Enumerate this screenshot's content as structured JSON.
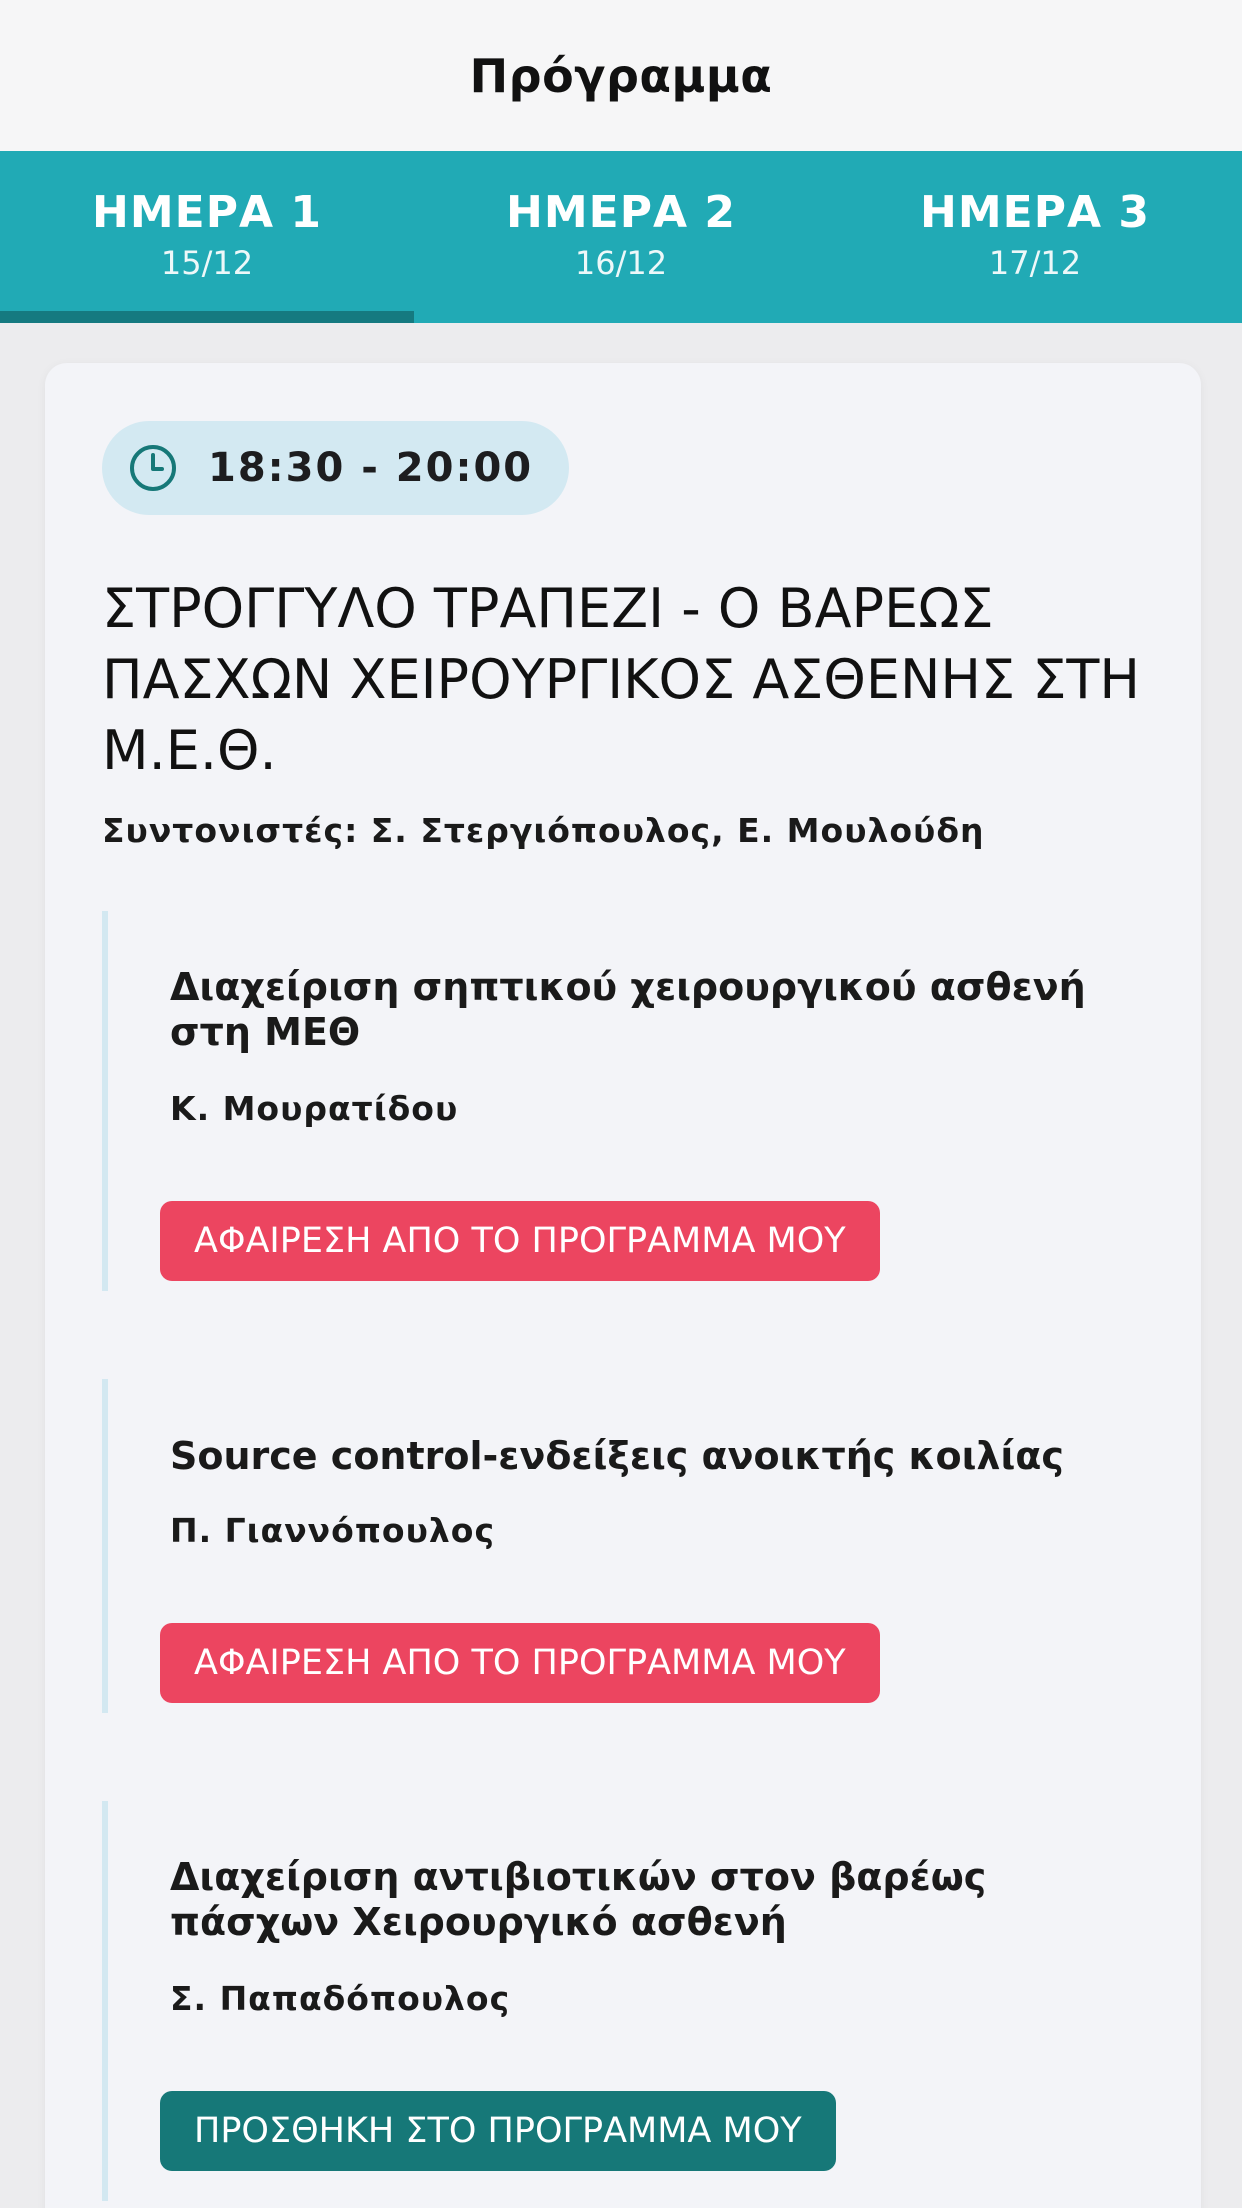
{
  "header": {
    "title": "Πρόγραμμα"
  },
  "tabs": [
    {
      "label": "ΗΜΕΡΑ 1",
      "date": "15/12",
      "active": true
    },
    {
      "label": "ΗΜΕΡΑ 2",
      "date": "16/12",
      "active": false
    },
    {
      "label": "ΗΜΕΡΑ 3",
      "date": "17/12",
      "active": false
    }
  ],
  "session": {
    "time": "18:30 - 20:00",
    "title": "ΣΤΡΟΓΓΥΛΟ ΤΡΑΠΕΖΙ - Ο ΒΑΡΕΩΣ ΠΑΣΧΩΝ ΧΕΙΡΟΥΡΓΙΚΟΣ ΑΣΘΕΝΗΣ ΣΤΗ Μ.Ε.Θ.",
    "coordinators": "Συντονιστές: Σ. Στεργιόπουλος, Ε. Μουλούδη"
  },
  "talks": [
    {
      "title": "Διαχείριση σηπτικού χειρουργικού ασθενή στη ΜΕΘ",
      "speaker": "Κ. Μουρατίδου",
      "button_label": "ΑΦΑΙΡΕΣΗ ΑΠΟ ΤΟ ΠΡΟΓΡΑΜΜΑ ΜΟΥ",
      "in_program": true
    },
    {
      "title": "Source control-ενδείξεις ανοικτής κοιλίας",
      "speaker": "Π. Γιαννόπουλος",
      "button_label": "ΑΦΑΙΡΕΣΗ ΑΠΟ ΤΟ ΠΡΟΓΡΑΜΜΑ ΜΟΥ",
      "in_program": true
    },
    {
      "title": "Διαχείριση αντιβιοτικών στον βαρέως πάσχων Χειρουργικό ασθενή",
      "speaker": "Σ. Παπαδόπουλος",
      "button_label": "ΠΡΟΣΘΗΚΗ ΣΤΟ ΠΡΟΓΡΑΜΜΑ ΜΟΥ",
      "in_program": false
    }
  ],
  "colors": {
    "tab_bar": "#21aab5",
    "tab_indicator": "#157a80",
    "remove_button": "#ec4560",
    "add_button": "#167878",
    "time_chip": "#d3e9f2"
  },
  "icons": {
    "time": "clock-icon"
  }
}
